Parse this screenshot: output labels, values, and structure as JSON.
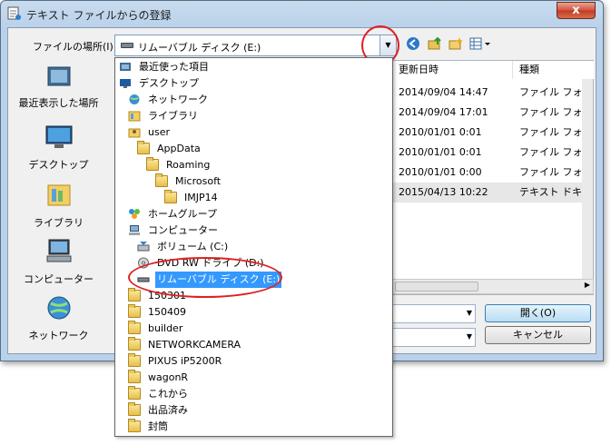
{
  "window": {
    "title": "テキスト ファイルからの登録",
    "close_label": "x"
  },
  "lookin": {
    "label": "ファイルの場所(I):",
    "value": "リムーバブル ディスク (E:)"
  },
  "places": [
    {
      "label": "最近表示した場所"
    },
    {
      "label": "デスクトップ"
    },
    {
      "label": "ライブラリ"
    },
    {
      "label": "コンピューター"
    },
    {
      "label": "ネットワーク"
    }
  ],
  "file_list": {
    "columns": [
      "更新日時",
      "種類"
    ],
    "rows": [
      {
        "date": "2014/09/04 14:47",
        "type": "ファイル フォ"
      },
      {
        "date": "2014/09/04 17:01",
        "type": "ファイル フォ"
      },
      {
        "date": "2010/01/01 0:01",
        "type": "ファイル フォ"
      },
      {
        "date": "2010/01/01 0:01",
        "type": "ファイル フォ"
      },
      {
        "date": "2010/01/01 0:00",
        "type": "ファイル フォ"
      },
      {
        "date": "2015/04/13 10:22",
        "type": "テキスト ドキ"
      }
    ]
  },
  "buttons": {
    "open": "開く(O)",
    "cancel": "キャンセル"
  },
  "dropdown": {
    "items": [
      {
        "label": "最近使った項目",
        "icon": "recent-icon"
      },
      {
        "label": "デスクトップ",
        "icon": "desktop-icon"
      },
      {
        "label": "ネットワーク",
        "icon": "network-icon"
      },
      {
        "label": "ライブラリ",
        "icon": "library-icon"
      },
      {
        "label": "user",
        "icon": "user-folder-icon"
      },
      {
        "label": "AppData",
        "icon": "folder-icon"
      },
      {
        "label": "Roaming",
        "icon": "folder-icon"
      },
      {
        "label": "Microsoft",
        "icon": "folder-icon"
      },
      {
        "label": "IMJP14",
        "icon": "folder-icon"
      },
      {
        "label": "ホームグループ",
        "icon": "homegroup-icon"
      },
      {
        "label": "コンピューター",
        "icon": "computer-icon"
      },
      {
        "label": "ボリューム (C:)",
        "icon": "disk-icon"
      },
      {
        "label": "DVD RW ドライブ (D:)",
        "icon": "dvd-icon"
      },
      {
        "label": "リムーバブル ディスク (E:)",
        "icon": "drive-icon"
      },
      {
        "label": "150301",
        "icon": "folder-icon"
      },
      {
        "label": "150409",
        "icon": "folder-icon"
      },
      {
        "label": "builder",
        "icon": "folder-icon"
      },
      {
        "label": "NETWORKCAMERA",
        "icon": "folder-icon"
      },
      {
        "label": "PIXUS iP5200R",
        "icon": "folder-icon"
      },
      {
        "label": "wagonR",
        "icon": "folder-icon"
      },
      {
        "label": "これから",
        "icon": "folder-icon"
      },
      {
        "label": "出品済み",
        "icon": "folder-icon"
      },
      {
        "label": "封筒",
        "icon": "folder-icon"
      }
    ]
  },
  "colors": {
    "selection": "#3399ff",
    "annotation": "#e02020",
    "title_bg": "#b9d1ea"
  }
}
